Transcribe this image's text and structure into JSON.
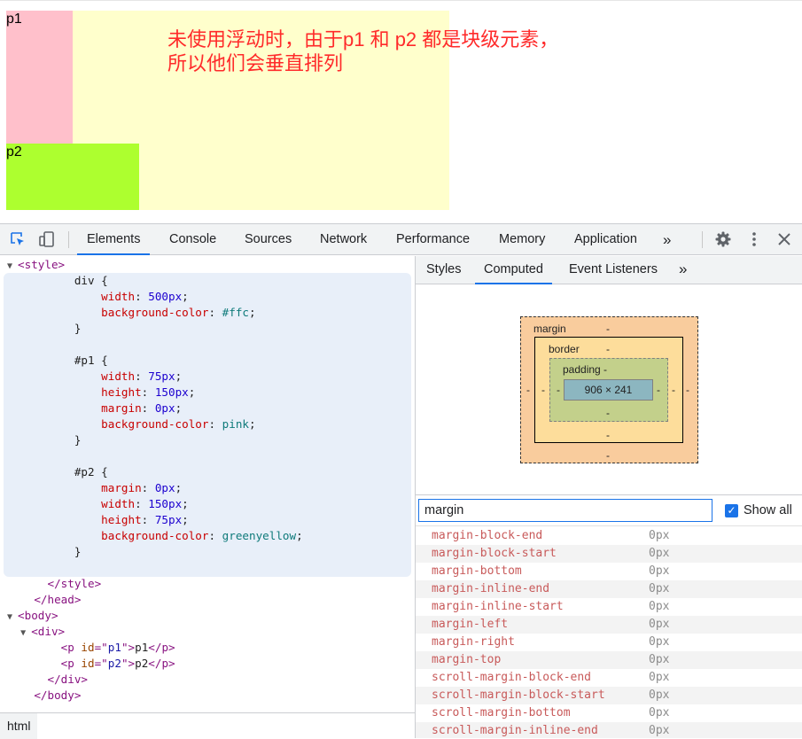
{
  "preview": {
    "p1_text": "p1",
    "p2_text": "p2",
    "annotation_line1": "未使用浮动时，由于p1 和 p2 都是块级元素，",
    "annotation_line2": "所以他们会垂直排列",
    "colors": {
      "div_bg": "#ffffcc",
      "p1_bg": "pink",
      "p2_bg": "greenyellow",
      "annotation": "#ff2a2a"
    }
  },
  "toolbar": {
    "icons": [
      "inspect-element-icon",
      "device-toggle-icon",
      "more-tabs-icon",
      "settings-gear-icon",
      "kebab-menu-icon",
      "close-icon"
    ],
    "tabs": [
      "Elements",
      "Console",
      "Sources",
      "Network",
      "Performance",
      "Memory",
      "Application"
    ],
    "more_label": "»",
    "active_tab": "Elements"
  },
  "elements": {
    "lines": [
      {
        "indent": "  ",
        "tri": "▼",
        "parts": [
          [
            "tag",
            "<style>"
          ]
        ]
      },
      {
        "indent": "          ",
        "parts": [
          [
            "txt",
            "div {"
          ]
        ]
      },
      {
        "indent": "              ",
        "parts": [
          [
            "prop",
            "width"
          ],
          [
            "txt",
            ": "
          ],
          [
            "num",
            "500px"
          ],
          [
            "txt",
            ";"
          ]
        ]
      },
      {
        "indent": "              ",
        "parts": [
          [
            "prop",
            "background-color"
          ],
          [
            "txt",
            ": "
          ],
          [
            "kw",
            "#ffc"
          ],
          [
            "txt",
            ";"
          ]
        ]
      },
      {
        "indent": "          ",
        "parts": [
          [
            "txt",
            "}"
          ]
        ]
      },
      {
        "indent": "",
        "parts": [
          [
            "txt",
            " "
          ]
        ]
      },
      {
        "indent": "          ",
        "parts": [
          [
            "txt",
            "#p1 {"
          ]
        ]
      },
      {
        "indent": "              ",
        "parts": [
          [
            "prop",
            "width"
          ],
          [
            "txt",
            ": "
          ],
          [
            "num",
            "75px"
          ],
          [
            "txt",
            ";"
          ]
        ]
      },
      {
        "indent": "              ",
        "parts": [
          [
            "prop",
            "height"
          ],
          [
            "txt",
            ": "
          ],
          [
            "num",
            "150px"
          ],
          [
            "txt",
            ";"
          ]
        ]
      },
      {
        "indent": "              ",
        "parts": [
          [
            "prop",
            "margin"
          ],
          [
            "txt",
            ": "
          ],
          [
            "num",
            "0px"
          ],
          [
            "txt",
            ";"
          ]
        ]
      },
      {
        "indent": "              ",
        "parts": [
          [
            "prop",
            "background-color"
          ],
          [
            "txt",
            ": "
          ],
          [
            "kw",
            "pink"
          ],
          [
            "txt",
            ";"
          ]
        ]
      },
      {
        "indent": "          ",
        "parts": [
          [
            "txt",
            "}"
          ]
        ]
      },
      {
        "indent": "",
        "parts": [
          [
            "txt",
            " "
          ]
        ]
      },
      {
        "indent": "          ",
        "parts": [
          [
            "txt",
            "#p2 {"
          ]
        ]
      },
      {
        "indent": "              ",
        "parts": [
          [
            "prop",
            "margin"
          ],
          [
            "txt",
            ": "
          ],
          [
            "num",
            "0px"
          ],
          [
            "txt",
            ";"
          ]
        ]
      },
      {
        "indent": "              ",
        "parts": [
          [
            "prop",
            "width"
          ],
          [
            "txt",
            ": "
          ],
          [
            "num",
            "150px"
          ],
          [
            "txt",
            ";"
          ]
        ]
      },
      {
        "indent": "              ",
        "parts": [
          [
            "prop",
            "height"
          ],
          [
            "txt",
            ": "
          ],
          [
            "num",
            "75px"
          ],
          [
            "txt",
            ";"
          ]
        ]
      },
      {
        "indent": "              ",
        "parts": [
          [
            "prop",
            "background-color"
          ],
          [
            "txt",
            ": "
          ],
          [
            "kw",
            "greenyellow"
          ],
          [
            "txt",
            ";"
          ]
        ]
      },
      {
        "indent": "          ",
        "parts": [
          [
            "txt",
            "}"
          ]
        ]
      },
      {
        "indent": "",
        "parts": [
          [
            "txt",
            " "
          ]
        ]
      },
      {
        "indent": "      ",
        "parts": [
          [
            "tag",
            "</style>"
          ]
        ]
      },
      {
        "indent": "    ",
        "parts": [
          [
            "tag",
            "</head>"
          ]
        ]
      },
      {
        "indent": "  ",
        "tri": "▼",
        "parts": [
          [
            "tag",
            "<body>"
          ]
        ]
      },
      {
        "indent": "    ",
        "tri": "▼",
        "parts": [
          [
            "tag",
            "<div>"
          ]
        ]
      },
      {
        "indent": "        ",
        "parts": [
          [
            "tag",
            "<p "
          ],
          [
            "attr",
            "id"
          ],
          [
            "tag",
            "=\""
          ],
          [
            "attrval",
            "p1"
          ],
          [
            "tag",
            "\">"
          ],
          [
            "txt",
            "p1"
          ],
          [
            "tag",
            "</p>"
          ]
        ]
      },
      {
        "indent": "        ",
        "parts": [
          [
            "tag",
            "<p "
          ],
          [
            "attr",
            "id"
          ],
          [
            "tag",
            "=\""
          ],
          [
            "attrval",
            "p2"
          ],
          [
            "tag",
            "\">"
          ],
          [
            "txt",
            "p2"
          ],
          [
            "tag",
            "</p>"
          ]
        ]
      },
      {
        "indent": "      ",
        "parts": [
          [
            "tag",
            "</div>"
          ]
        ]
      },
      {
        "indent": "    ",
        "parts": [
          [
            "tag",
            "</body>"
          ]
        ]
      }
    ],
    "breadcrumb": "html"
  },
  "sidebar": {
    "tabs": [
      "Styles",
      "Computed",
      "Event Listeners"
    ],
    "more_label": "»",
    "active_tab": "Computed",
    "box_model": {
      "margin_label": "margin",
      "border_label": "border",
      "padding_label": "padding -",
      "content_size": "906 × 241",
      "dash": "-"
    },
    "filter_value": "margin",
    "show_all_label": "Show all",
    "show_all_checked": true,
    "computed": [
      {
        "name": "margin-block-end",
        "value": "0px"
      },
      {
        "name": "margin-block-start",
        "value": "0px"
      },
      {
        "name": "margin-bottom",
        "value": "0px"
      },
      {
        "name": "margin-inline-end",
        "value": "0px"
      },
      {
        "name": "margin-inline-start",
        "value": "0px"
      },
      {
        "name": "margin-left",
        "value": "0px"
      },
      {
        "name": "margin-right",
        "value": "0px"
      },
      {
        "name": "margin-top",
        "value": "0px"
      },
      {
        "name": "scroll-margin-block-end",
        "value": "0px"
      },
      {
        "name": "scroll-margin-block-start",
        "value": "0px"
      },
      {
        "name": "scroll-margin-bottom",
        "value": "0px"
      },
      {
        "name": "scroll-margin-inline-end",
        "value": "0px"
      }
    ]
  }
}
